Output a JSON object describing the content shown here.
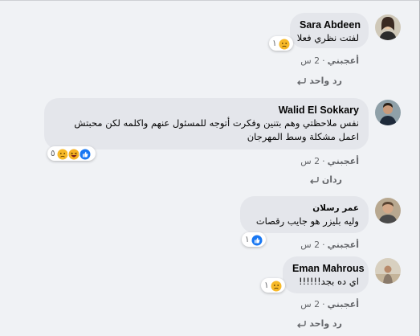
{
  "comments": [
    {
      "author": "Sara Abdeen",
      "text": [
        "لفتت نظري فعلا"
      ],
      "reactions": {
        "count": "١",
        "icons": [
          "sad-icon"
        ]
      },
      "like_label": "أعجبني",
      "time": "2 س",
      "reply_label": "رد واحد"
    },
    {
      "author": "Walid El Sokkary",
      "text": [
        "نفس ملاحظتي وهم بتنين وفكرت أتوجه للمسئول عنهم واكلمه لكن محبتش",
        "اعمل مشكلة وسط المهرجان"
      ],
      "reactions": {
        "count": "٥",
        "icons": [
          "like-icon",
          "haha-icon",
          "sad-icon"
        ]
      },
      "like_label": "أعجبني",
      "time": "2 س",
      "reply_label": "ردان"
    },
    {
      "author": "عمر رسلان",
      "text": [
        "وليه بليزر هو جايب رقصات"
      ],
      "reactions": {
        "count": "١",
        "icons": [
          "like-icon"
        ]
      },
      "like_label": "أعجبني",
      "time": "2 س",
      "reply_label": ""
    },
    {
      "author": "Eman Mahrous",
      "text": [
        "اي ده بجد!!!!!!"
      ],
      "reactions": {
        "count": "١",
        "icons": [
          "sad-icon"
        ]
      },
      "like_label": "أعجبني",
      "time": "2 س",
      "reply_label": "رد واحد"
    }
  ],
  "colors": {
    "bubble": "#e4e6eb",
    "page_bg": "#f0f2f5",
    "meta_text": "#65676b",
    "like_blue": "#1877f2",
    "haha_yellow": "#f7b125",
    "sad_yellow": "#f7b928"
  }
}
